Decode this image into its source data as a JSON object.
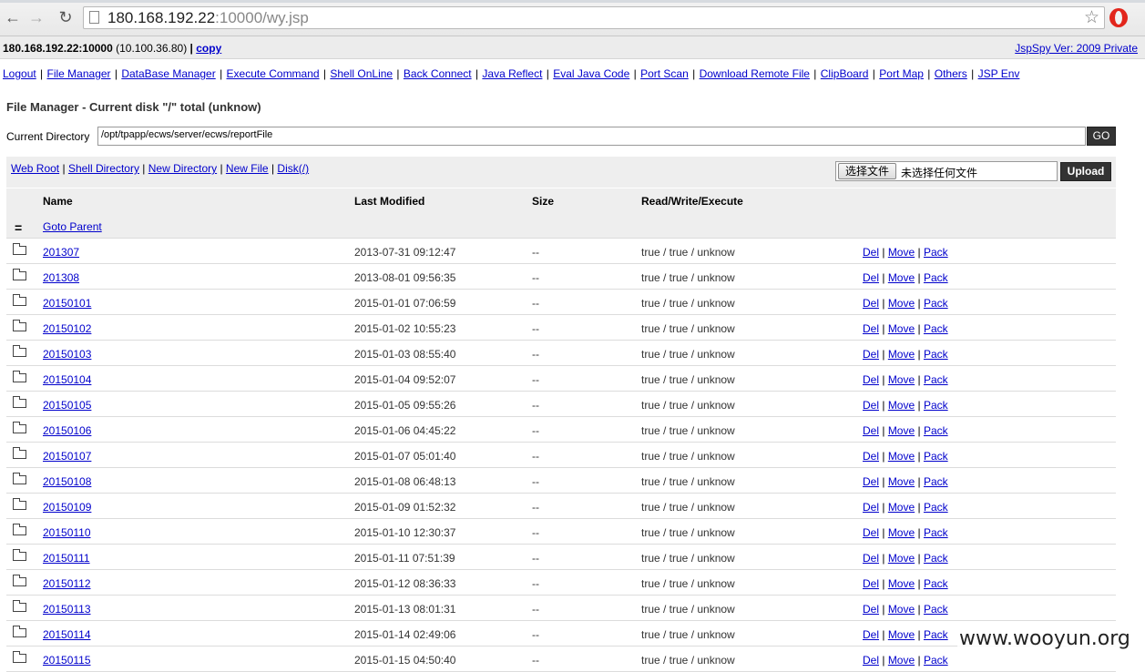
{
  "browser": {
    "url_host": "180.168.192.22",
    "url_rest": ":10000/wy.jsp"
  },
  "info": {
    "server": "180.168.192.22:10000",
    "local_ip": "(10.100.36.80)",
    "separator": "|",
    "copy_label": "copy",
    "version": "JspSpy Ver: 2009 Private"
  },
  "menu": [
    "Logout",
    "File Manager",
    "DataBase Manager",
    "Execute Command",
    "Shell OnLine",
    "Back Connect",
    "Java Reflect",
    "Eval Java Code",
    "Port Scan",
    "Download Remote File",
    "ClipBoard",
    "Port Map",
    "Others",
    "JSP Env"
  ],
  "title": "File Manager - Current disk \"/\" total (unknow)",
  "current_directory": {
    "label": "Current Directory",
    "value": "/opt/tpapp/ecws/server/ecws/reportFile",
    "go_label": "GO"
  },
  "toolbar": {
    "links": [
      "Web Root",
      "Shell Directory",
      "New Directory",
      "New File",
      "Disk(/)"
    ],
    "choose_file_label": "选择文件",
    "no_file_label": "未选择任何文件",
    "upload_label": "Upload"
  },
  "table": {
    "headers": {
      "name": "Name",
      "modified": "Last Modified",
      "size": "Size",
      "rwe": "Read/Write/Execute"
    },
    "parent_icon": "=",
    "parent_label": "Goto Parent",
    "action_labels": [
      "Del",
      "Move",
      "Pack"
    ],
    "rows": [
      {
        "name": "201307",
        "modified": "2013-07-31 09:12:47",
        "size": "--",
        "rwe": "true / true / unknow"
      },
      {
        "name": "201308",
        "modified": "2013-08-01 09:56:35",
        "size": "--",
        "rwe": "true / true / unknow"
      },
      {
        "name": "20150101",
        "modified": "2015-01-01 07:06:59",
        "size": "--",
        "rwe": "true / true / unknow"
      },
      {
        "name": "20150102",
        "modified": "2015-01-02 10:55:23",
        "size": "--",
        "rwe": "true / true / unknow"
      },
      {
        "name": "20150103",
        "modified": "2015-01-03 08:55:40",
        "size": "--",
        "rwe": "true / true / unknow"
      },
      {
        "name": "20150104",
        "modified": "2015-01-04 09:52:07",
        "size": "--",
        "rwe": "true / true / unknow"
      },
      {
        "name": "20150105",
        "modified": "2015-01-05 09:55:26",
        "size": "--",
        "rwe": "true / true / unknow"
      },
      {
        "name": "20150106",
        "modified": "2015-01-06 04:45:22",
        "size": "--",
        "rwe": "true / true / unknow"
      },
      {
        "name": "20150107",
        "modified": "2015-01-07 05:01:40",
        "size": "--",
        "rwe": "true / true / unknow"
      },
      {
        "name": "20150108",
        "modified": "2015-01-08 06:48:13",
        "size": "--",
        "rwe": "true / true / unknow"
      },
      {
        "name": "20150109",
        "modified": "2015-01-09 01:52:32",
        "size": "--",
        "rwe": "true / true / unknow"
      },
      {
        "name": "20150110",
        "modified": "2015-01-10 12:30:37",
        "size": "--",
        "rwe": "true / true / unknow"
      },
      {
        "name": "20150111",
        "modified": "2015-01-11 07:51:39",
        "size": "--",
        "rwe": "true / true / unknow"
      },
      {
        "name": "20150112",
        "modified": "2015-01-12 08:36:33",
        "size": "--",
        "rwe": "true / true / unknow"
      },
      {
        "name": "20150113",
        "modified": "2015-01-13 08:01:31",
        "size": "--",
        "rwe": "true / true / unknow"
      },
      {
        "name": "20150114",
        "modified": "2015-01-14 02:49:06",
        "size": "--",
        "rwe": "true / true / unknow"
      },
      {
        "name": "20150115",
        "modified": "2015-01-15 04:50:40",
        "size": "--",
        "rwe": "true / true / unknow"
      }
    ]
  },
  "watermark": "www.wooyun.org"
}
